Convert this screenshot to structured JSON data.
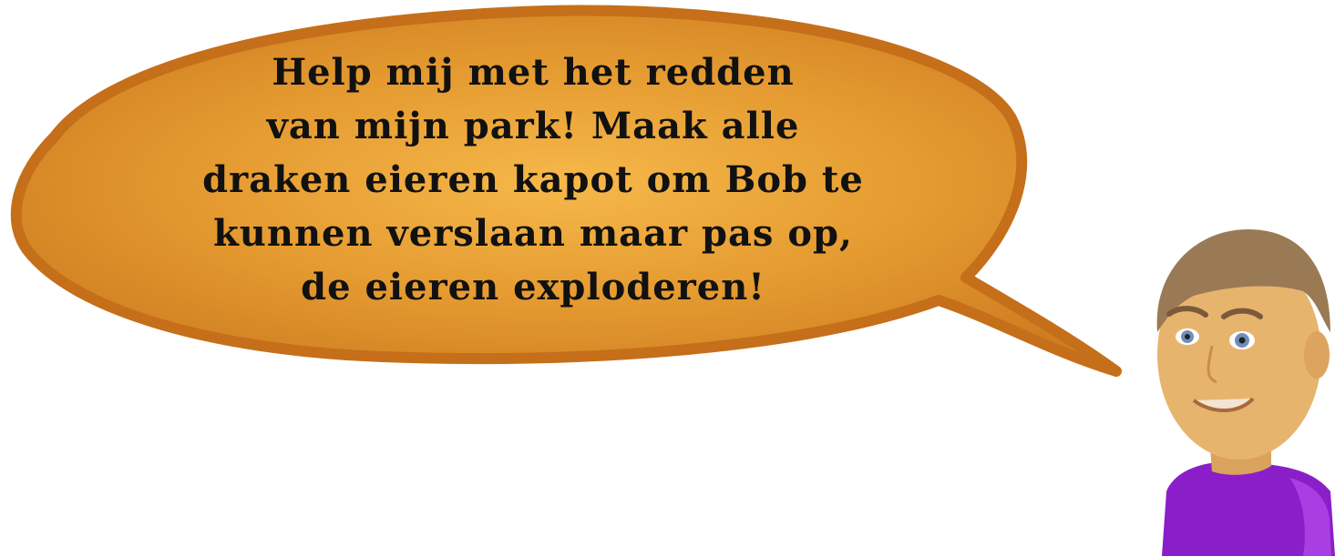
{
  "dialog": {
    "lines": [
      "Help mij met het redden",
      "van mijn park! Maak alle",
      "draken eieren kapot om Bob te",
      "kunnen verslaan maar pas op,",
      "de eieren exploderen!"
    ]
  },
  "colors": {
    "bubble_fill": "#e39a2f",
    "bubble_center": "#f0ad3c",
    "bubble_edge": "#c9731c",
    "text": "#111111",
    "skin": "#e7b46e",
    "hair": "#9a7a55",
    "shirt": "#8a1fc9",
    "eyes": "#6f8fb8"
  },
  "icons": {
    "bubble": "speech-bubble",
    "character": "park-owner-character"
  }
}
